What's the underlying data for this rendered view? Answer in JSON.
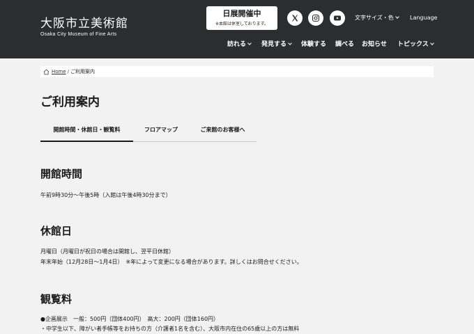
{
  "header": {
    "logo_ja": "大阪市立美術館",
    "logo_en": "Osaka City Museum of  Fine Arts",
    "notice_title": "日展開催中",
    "notice_sub": "※本館は休室しております。",
    "font_size_label": "文字サイズ・色",
    "language_label": "Language",
    "sns_icons": [
      "x-icon",
      "instagram-icon",
      "youtube-icon"
    ],
    "nav": [
      {
        "label": "訪れる",
        "dropdown": true
      },
      {
        "label": "発見する",
        "dropdown": true
      },
      {
        "label": "体験する",
        "dropdown": false
      },
      {
        "label": "調べる",
        "dropdown": false
      },
      {
        "label": "お知らせ",
        "dropdown": false
      },
      {
        "label": "トピックス",
        "dropdown": true
      }
    ]
  },
  "breadcrumb": {
    "home": "Home",
    "separator": "/",
    "current": "ご利用案内"
  },
  "page_title": "ご利用案内",
  "tabs": [
    {
      "label": "開館時間・休館日・観覧料",
      "active": true
    },
    {
      "label": "フロアマップ",
      "active": false
    },
    {
      "label": "ご来館のお客様へ",
      "active": false
    }
  ],
  "sections": {
    "hours": {
      "heading": "開館時間",
      "lines": [
        "午前9時30分～午後5時（入館は午後4時30分まで）"
      ]
    },
    "closed": {
      "heading": "休館日",
      "lines": [
        "月曜日（月曜日が祝日の場合は開館し、翌平日休館）",
        "年末年始（12月28日～1月4日）　※年によって変更になる場合があります。詳しくはお問合せください。"
      ]
    },
    "fees": {
      "heading": "観覧料",
      "lines": [
        "●企画展示　一般：500円（団体400円）　高大：200円（団体160円）",
        "・中学生以下、障がい者手帳等をお持ちの方（介護者1名を含む）、大阪市内在住の65歳以上の方は無料"
      ]
    }
  },
  "colors": {
    "header_bg": "#2b2d2f",
    "page_bg": "#f2f2f2",
    "text": "#1a1a1a"
  }
}
